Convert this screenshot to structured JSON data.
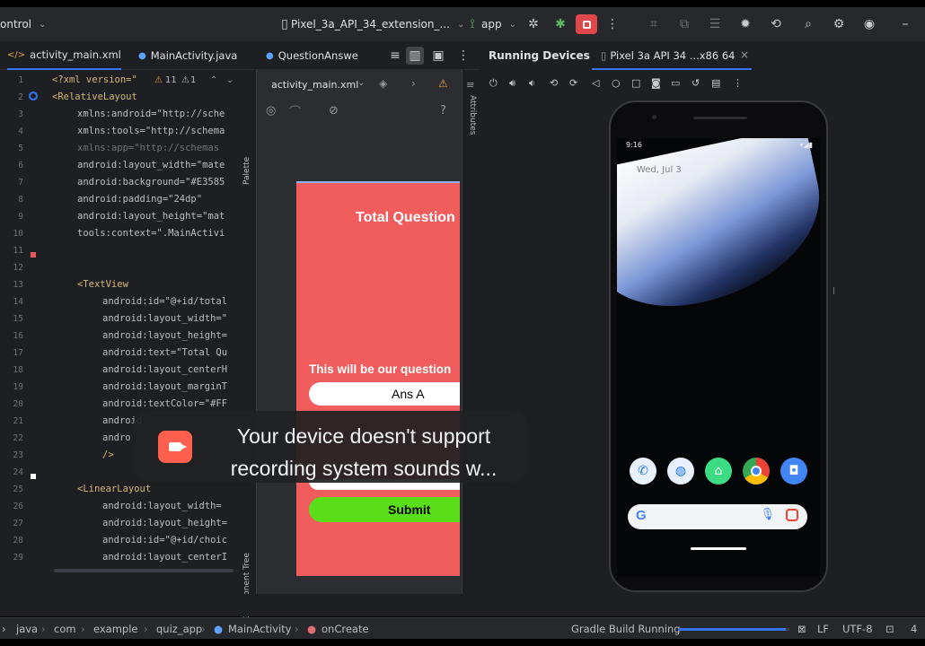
{
  "toolbar": {
    "project_label": "ontrol",
    "device_selector": "Pixel_3a_API_34_extension_...",
    "run_config": "app"
  },
  "editor_tabs": [
    {
      "label": "activity_main.xml",
      "active": true
    },
    {
      "label": "MainActivity.java",
      "active": false
    },
    {
      "label": "QuestionAnswe",
      "active": false
    }
  ],
  "running_devices": {
    "title": "Running Devices",
    "device_tab": "Pixel 3a API 34 ...x86 64"
  },
  "code": {
    "warnings": "11",
    "errors": "1",
    "line_numbers": [
      "1",
      "2",
      "3",
      "4",
      "5",
      "6",
      "7",
      "8",
      "9",
      "10",
      "11",
      "12",
      "13",
      "14",
      "15",
      "16",
      "17",
      "18",
      "19",
      "20",
      "21",
      "22",
      "23",
      "24",
      "25",
      "26",
      "27",
      "28",
      "29"
    ],
    "lines": [
      "<?xml version=\"",
      "<RelativeLayout",
      "xmlns:android=\"http://sche",
      "xmlns:tools=\"http://schema",
      "xmlns:app=\"http://schemas",
      "android:layout_width=\"mate",
      "android:background=\"#E3585",
      "android:padding=\"24dp\"",
      "android:layout_height=\"mat",
      "tools:context=\".MainActivi",
      "",
      "",
      "<TextView",
      "android:id=\"@+id/total",
      "android:layout_width=\"",
      "android:layout_height=",
      "android:text=\"Total Qu",
      "android:layout_centerH",
      "android:layout_marginT",
      "android:textColor=\"#FF",
      "android",
      "andro",
      "/>",
      "",
      "<LinearLayout",
      "android:layout_width=",
      "android:layout_height=",
      "android:id=\"@+id/choic",
      "android:layout_centerI"
    ]
  },
  "preview": {
    "file_selector": "activity_main.xml",
    "palette_label": "Palette",
    "attributes_label": "Attributes",
    "component_tree_label": "Component Tree",
    "help": "?",
    "title_text": "Total Question",
    "question_text": "This will be our question",
    "ans_a": "Ans A",
    "submit": "Submit"
  },
  "phone": {
    "status_time": "9:16",
    "date_text": "Wed, Jul 3"
  },
  "toast": {
    "message": "Your device doesn't support recording system sounds w..."
  },
  "statusbar": {
    "breadcrumbs": [
      "java",
      "com",
      "example",
      "quiz_app",
      "MainActivity",
      "onCreate"
    ],
    "build_status": "Gradle Build Running",
    "build_progress": 0.97,
    "line_ending": "LF",
    "encoding": "UTF-8",
    "indent": "4"
  },
  "colors": {
    "preview_bg": "#f15c5c",
    "submit_bg": "#59de17",
    "stop_button": "#e0474a",
    "accent": "#3574f0"
  }
}
